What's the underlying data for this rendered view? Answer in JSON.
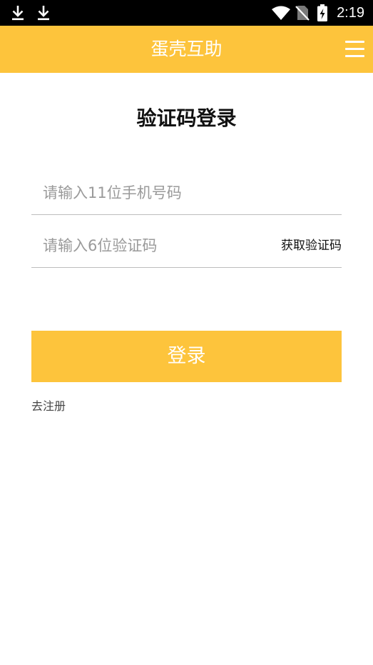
{
  "status_bar": {
    "time": "2:19",
    "icons": [
      "download-icon",
      "download-icon",
      "wifi-icon",
      "no-sim-icon",
      "battery-charging-icon"
    ]
  },
  "app_bar": {
    "title": "蛋壳互助",
    "menu_icon": "menu-icon",
    "background_color": "#fdc43c"
  },
  "page": {
    "title": "验证码登录"
  },
  "form": {
    "phone_placeholder": "请输入11位手机号码",
    "phone_value": "",
    "code_placeholder": "请输入6位验证码",
    "code_value": "",
    "get_code_label": "获取验证码"
  },
  "actions": {
    "login_label": "登录",
    "register_label": "去注册",
    "accent_color": "#fdc43c"
  }
}
